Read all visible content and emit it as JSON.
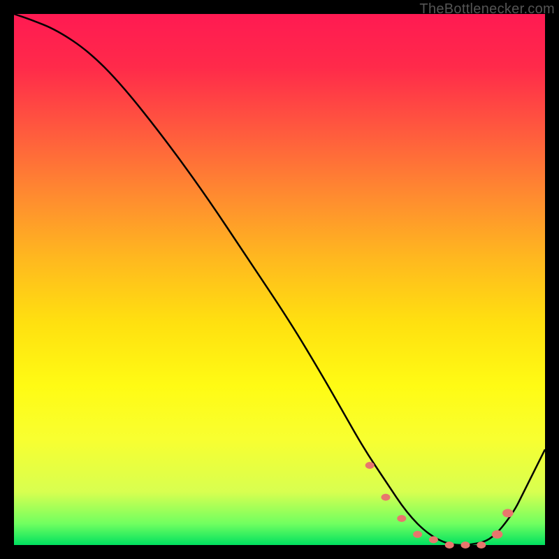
{
  "watermark": "TheBottlenecker.com",
  "colors": {
    "curve": "#000000",
    "marker": "#e8766d",
    "gradient_top": "#ff1a52",
    "gradient_bottom": "#00e060"
  },
  "chart_data": {
    "type": "line",
    "title": "",
    "xlabel": "",
    "ylabel": "",
    "xlim": [
      0,
      100
    ],
    "ylim": [
      0,
      100
    ],
    "series": [
      {
        "name": "bottleneck-curve",
        "x": [
          0,
          3,
          8,
          14,
          20,
          28,
          36,
          44,
          52,
          58,
          62,
          66,
          70,
          74,
          78,
          82,
          86,
          90,
          94,
          96,
          100
        ],
        "y": [
          100,
          99,
          97,
          93,
          87,
          77,
          66,
          54,
          42,
          32,
          25,
          18,
          12,
          6,
          2,
          0,
          0,
          1,
          6,
          10,
          18
        ]
      }
    ],
    "markers": {
      "name": "trough-points",
      "x": [
        67,
        70,
        73,
        76,
        79,
        82,
        85,
        88,
        91,
        93
      ],
      "y": [
        15,
        9,
        5,
        2,
        1,
        0,
        0,
        0,
        2,
        6
      ],
      "radius": [
        5,
        5,
        5,
        5,
        5,
        5,
        5,
        5,
        6,
        6
      ]
    }
  }
}
